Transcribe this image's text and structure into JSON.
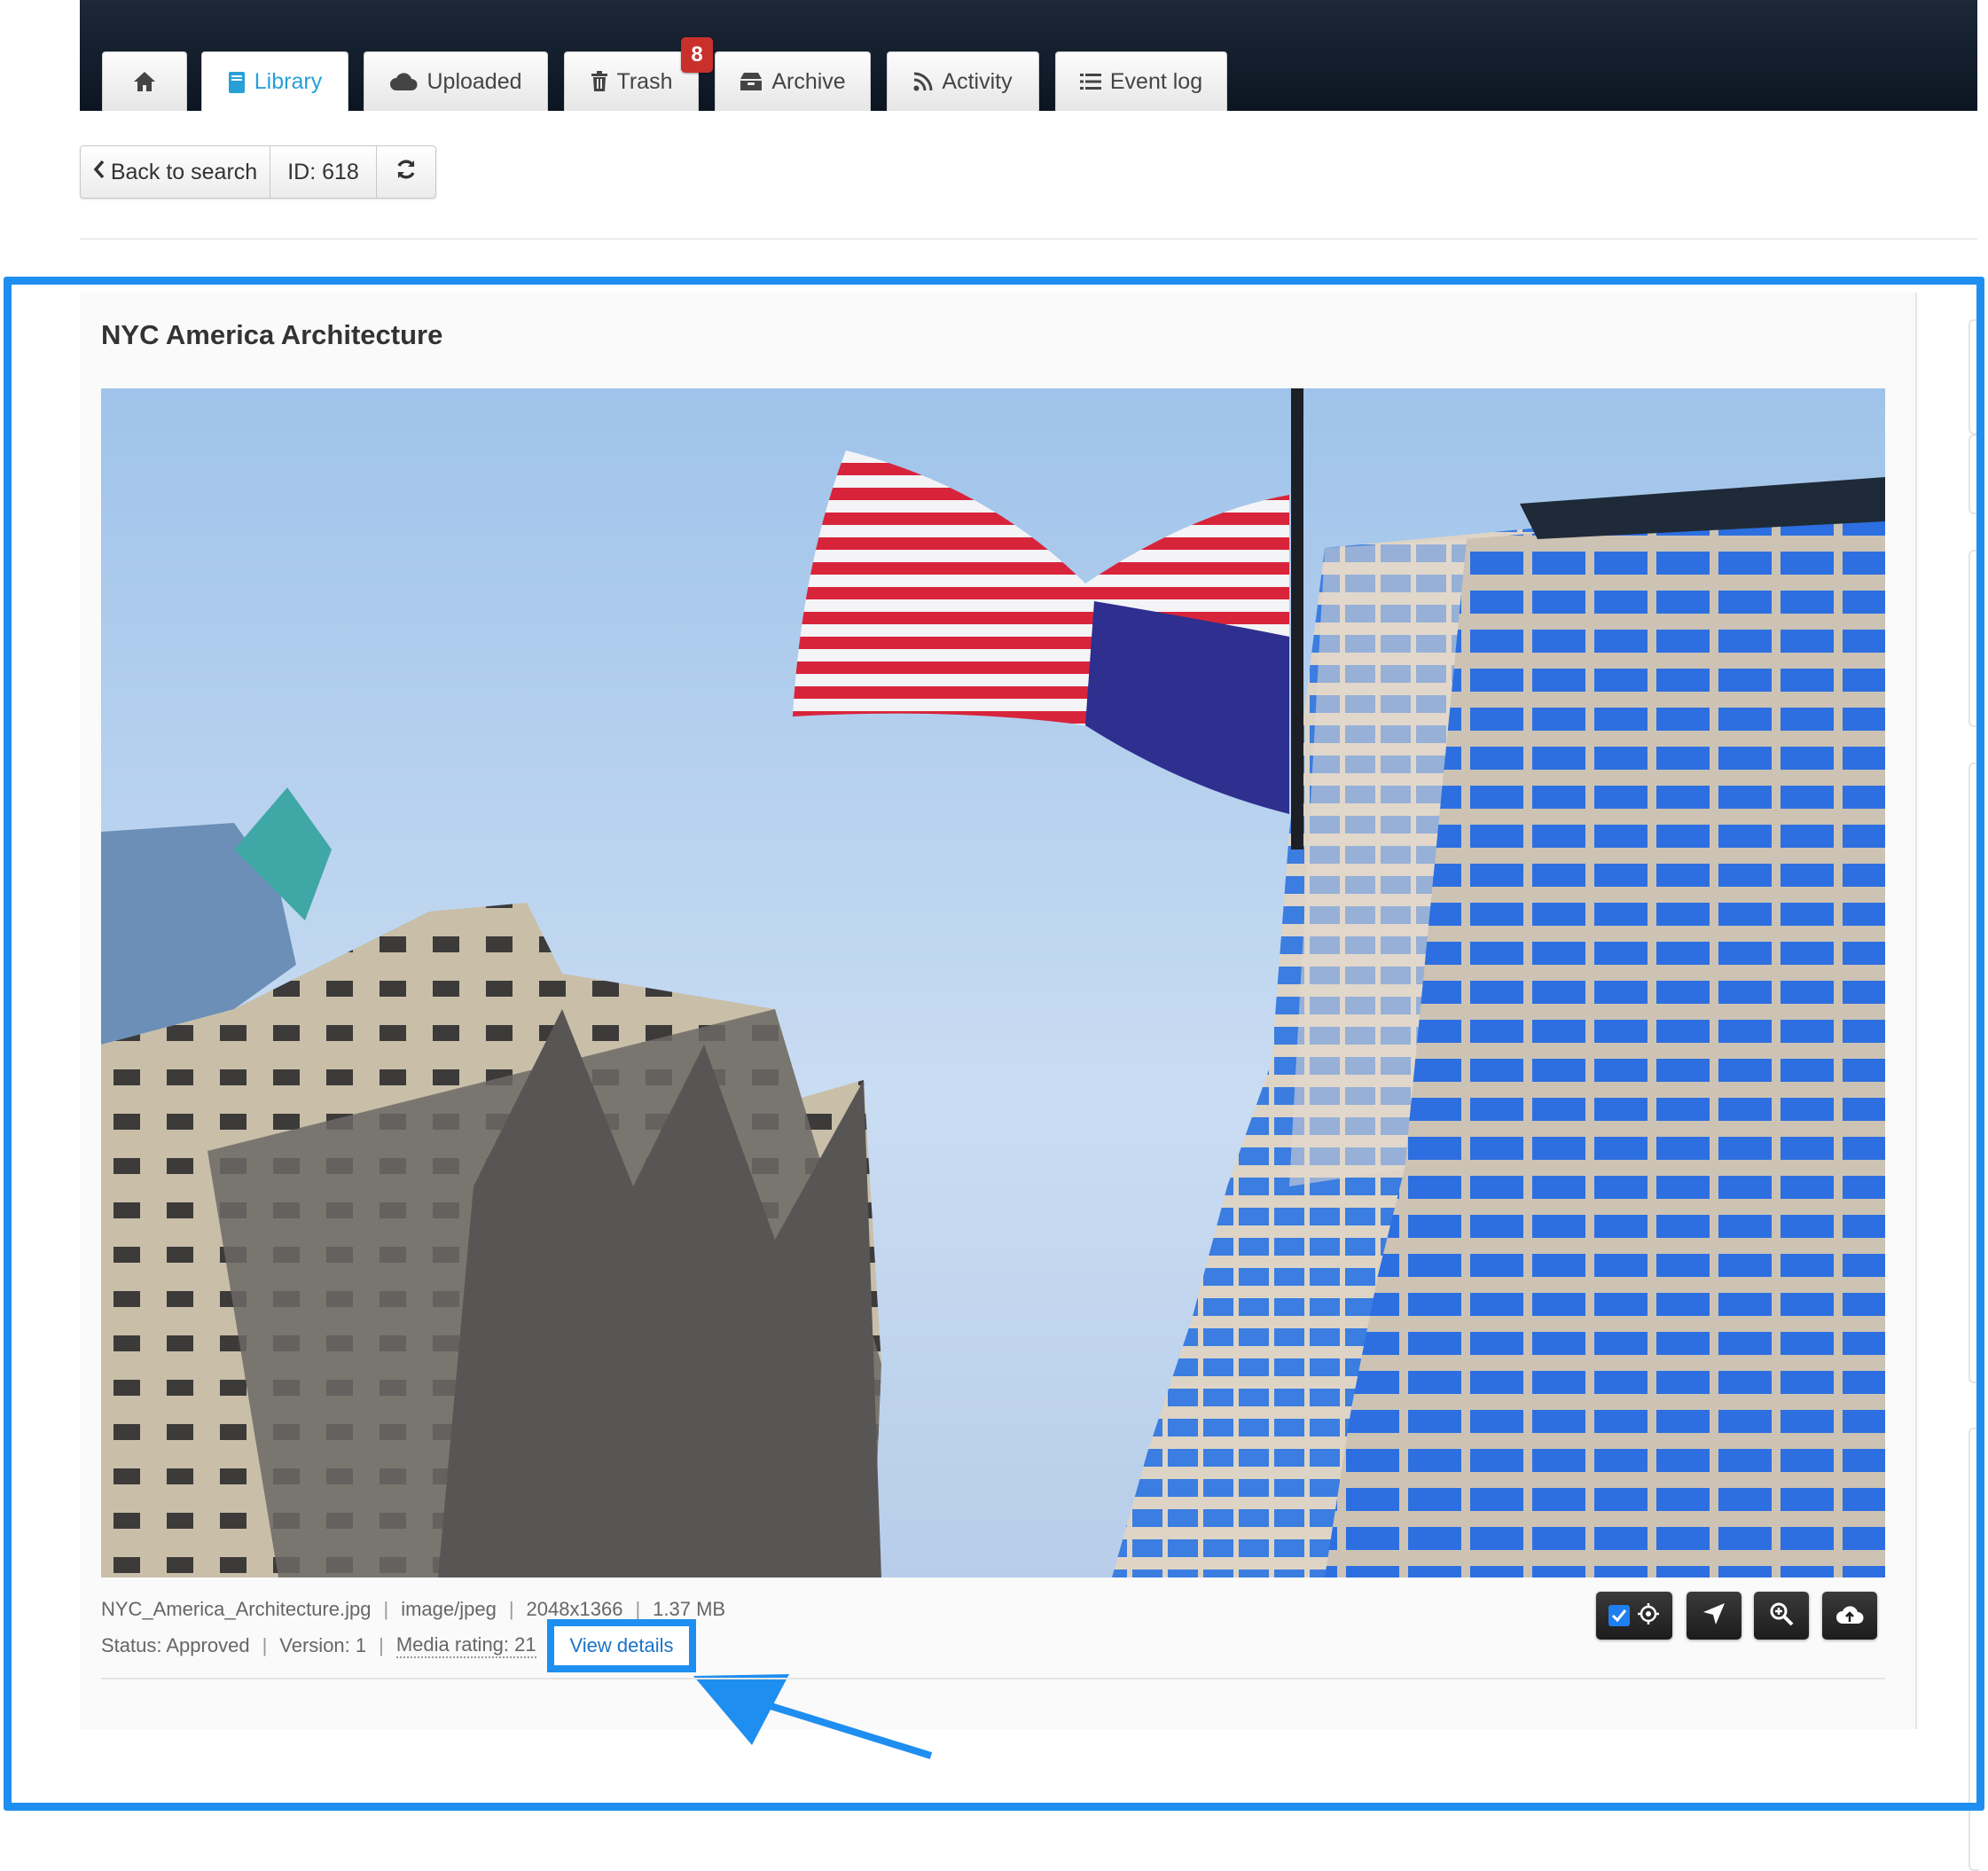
{
  "nav": {
    "tabs": [
      {
        "label": "",
        "icon": "home-icon"
      },
      {
        "label": "Library",
        "icon": "book-icon",
        "active": true
      },
      {
        "label": "Uploaded",
        "icon": "cloud-icon"
      },
      {
        "label": "Trash",
        "icon": "trash-icon",
        "badge": "8"
      },
      {
        "label": "Archive",
        "icon": "archive-icon"
      },
      {
        "label": "Activity",
        "icon": "rss-icon"
      },
      {
        "label": "Event log",
        "icon": "list-icon"
      }
    ]
  },
  "toolbar": {
    "back_label": "Back to search",
    "id_label": "ID: 618",
    "refresh_icon": "refresh-icon"
  },
  "asset": {
    "title": "NYC America Architecture",
    "filename": "NYC_America_Architecture.jpg",
    "mime": "image/jpeg",
    "dimensions": "2048x1366",
    "size": "1.37 MB",
    "status": "Status: Approved",
    "version": "Version: 1",
    "rating": "Media rating: 21",
    "view_details": "View details"
  },
  "actions": [
    "select-checkbox-crosshair",
    "navigate-icon",
    "zoom-in-icon",
    "cloud-upload-icon"
  ],
  "colors": {
    "nav_bg": "#0b1522",
    "active_tab_text": "#27a0d8",
    "highlight": "#1e8ef0",
    "badge": "#c9302c"
  }
}
